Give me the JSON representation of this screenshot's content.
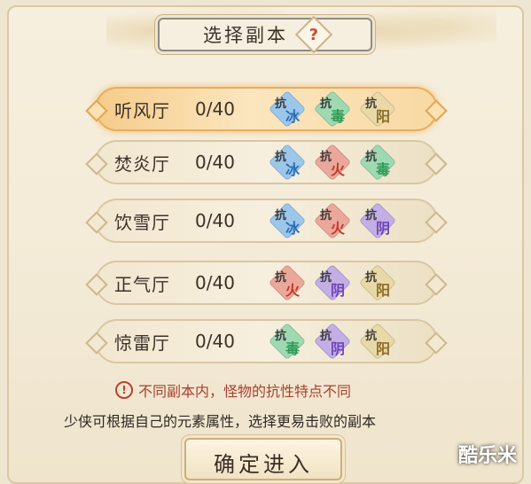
{
  "title": "选择副本",
  "help_symbol": "?",
  "dungeons": [
    {
      "name": "听风厅",
      "count": "0/40",
      "selected": true,
      "badges": [
        {
          "top": "抗",
          "bottom": "冰",
          "element": "ice"
        },
        {
          "top": "抗",
          "bottom": "毒",
          "element": "poison"
        },
        {
          "top": "抗",
          "bottom": "阳",
          "element": "yang"
        }
      ]
    },
    {
      "name": "焚炎厅",
      "count": "0/40",
      "selected": false,
      "badges": [
        {
          "top": "抗",
          "bottom": "冰",
          "element": "ice"
        },
        {
          "top": "抗",
          "bottom": "火",
          "element": "fire"
        },
        {
          "top": "抗",
          "bottom": "毒",
          "element": "poison"
        }
      ]
    },
    {
      "name": "饮雪厅",
      "count": "0/40",
      "selected": false,
      "badges": [
        {
          "top": "抗",
          "bottom": "冰",
          "element": "ice"
        },
        {
          "top": "抗",
          "bottom": "火",
          "element": "fire"
        },
        {
          "top": "抗",
          "bottom": "阴",
          "element": "yin"
        }
      ]
    },
    {
      "name": "正气厅",
      "count": "0/40",
      "selected": false,
      "badges": [
        {
          "top": "抗",
          "bottom": "火",
          "element": "fire"
        },
        {
          "top": "抗",
          "bottom": "阴",
          "element": "yin"
        },
        {
          "top": "抗",
          "bottom": "阳",
          "element": "yang"
        }
      ]
    },
    {
      "name": "惊雷厅",
      "count": "0/40",
      "selected": false,
      "badges": [
        {
          "top": "抗",
          "bottom": "毒",
          "element": "poison"
        },
        {
          "top": "抗",
          "bottom": "阴",
          "element": "yin"
        },
        {
          "top": "抗",
          "bottom": "阳",
          "element": "yang"
        }
      ]
    }
  ],
  "element_colors": {
    "ice": {
      "bg": "#9cc6ea",
      "text": "#2a6fb8"
    },
    "poison": {
      "bg": "#9fd9b2",
      "text": "#2f9a55"
    },
    "yang": {
      "bg": "#e9d9a6",
      "text": "#8c6d2a"
    },
    "fire": {
      "bg": "#eba89a",
      "text": "#c0392b"
    },
    "yin": {
      "bg": "#c3aee6",
      "text": "#6d45b8"
    }
  },
  "notice": {
    "icon": "!",
    "text": "不同副本内，怪物的抗性特点不同"
  },
  "hint": "少侠可根据自己的元素属性，选择更易击败的副本",
  "confirm_label": "确定进入",
  "watermark": "酷乐米"
}
